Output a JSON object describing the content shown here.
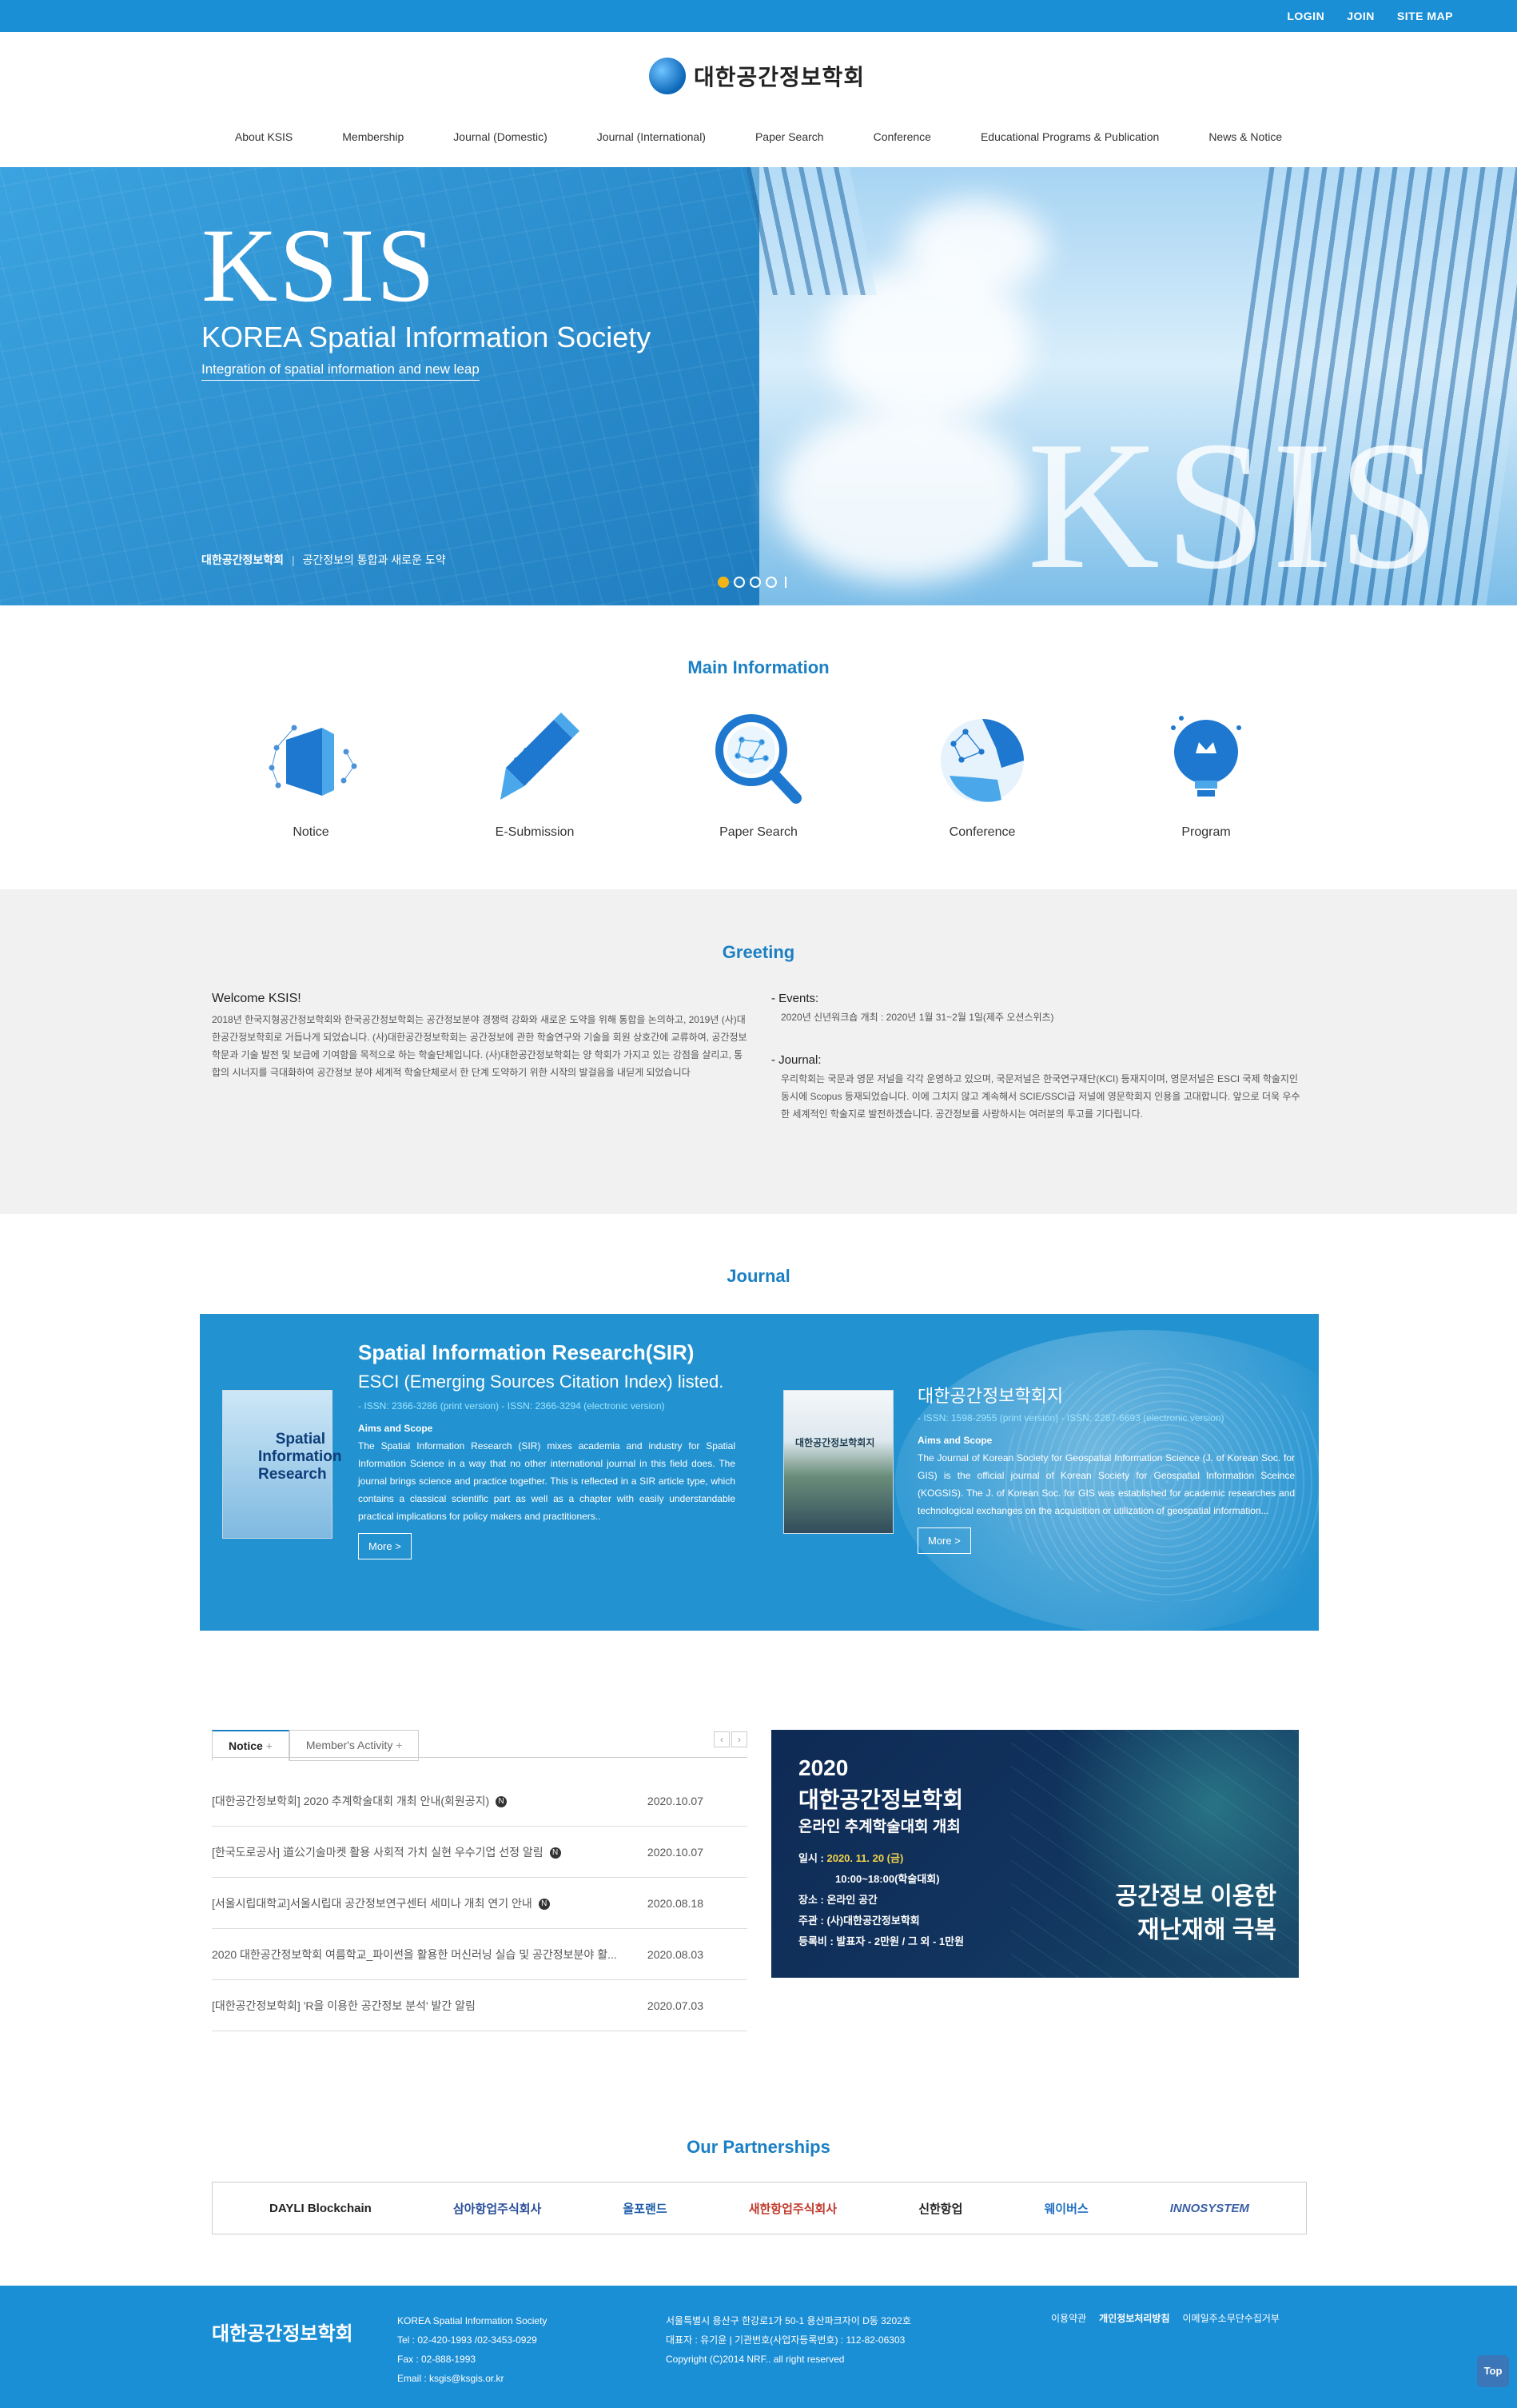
{
  "topbar": {
    "login": "LOGIN",
    "join": "JOIN",
    "sitemap": "SITE MAP"
  },
  "header": {
    "logo_text": "대한공간정보학회"
  },
  "nav": {
    "items": [
      "About KSIS",
      "Membership",
      "Journal (Domestic)",
      "Journal (International)",
      "Paper Search",
      "Conference",
      "Educational Programs & Publication",
      "News & Notice"
    ]
  },
  "hero": {
    "title": "KSIS",
    "subtitle": "KOREA Spatial Information Society",
    "tagline": "Integration of spatial information and new leap",
    "caption_bold": "대한공간정보학회",
    "caption_sep": "|",
    "caption": "공간정보의 통합과 새로운 도약",
    "bg_text": "KSIS",
    "slides": 4,
    "active_slide": 1
  },
  "main_info": {
    "title": "Main Information",
    "items": [
      {
        "label": "Notice",
        "icon": "notice-icon"
      },
      {
        "label": "E-Submission",
        "icon": "pen-icon"
      },
      {
        "label": "Paper Search",
        "icon": "magnifier-icon"
      },
      {
        "label": "Conference",
        "icon": "globe-network-icon"
      },
      {
        "label": "Program",
        "icon": "lightbulb-icon"
      }
    ]
  },
  "greeting": {
    "title": "Greeting",
    "welcome": "Welcome KSIS!",
    "body": "2018년 한국지형공간정보학회와 한국공간정보학회는 공간정보분야 경쟁력 강화와 새로운 도약을 위해 통합을 논의하고, 2019년 (사)대한공간정보학회로 거듭나게 되었습니다. (사)대한공간정보학회는 공간정보에 관한 학술연구와 기술을 회원 상호간에 교류하여, 공간정보 학문과 기술 발전 및 보급에 기여함을 목적으로 하는 학술단체입니다. (사)대한공간정보학회는 양 학회가 가지고 있는 강점을 살리고, 통합의 시너지를 극대화하여 공간정보 분야 세계적 학술단체로서 한 단계 도약하기 위한 시작의 발걸음을 내딛게 되었습니다",
    "events_title": "- Events:",
    "events_body": "2020년 신년워크숍 개최 : 2020년 1월 31~2월 1일(제주 오션스위츠)",
    "journal_title": "- Journal:",
    "journal_body": "우리학회는 국문과 영문 저널을 각각 운영하고 있으며, 국문저널은 한국연구재단(KCI) 등재지이며, 영문저널은 ESCI 국제 학술지인 동시에 Scopus 등재되었습니다. 이에 그치지 않고 계속해서 SCIE/SSCI급 저널에 영문학회지 인용을 고대합니다. 앞으로 더욱 우수한 세계적인 학술지로 발전하겠습니다. 공간정보를 사랑하시는 여러분의 투고를 기다립니다."
  },
  "journal": {
    "title": "Journal",
    "sir": {
      "cover_text": "Spatial Information Research",
      "name": "Spatial Information Research(SIR)",
      "listed": "ESCI (Emerging Sources Citation Index) listed.",
      "issn": "- ISSN: 2366-3286 (print version) - ISSN: 2366-3294 (electronic version)",
      "aims": "Aims and Scope",
      "body": "The Spatial Information Research (SIR) mixes academia and industry for Spatial Information Science in a way that no other international journal in this field does. The journal brings science and practice together. This is reflected in a SIR article type, which contains a classical scientific part as well as a chapter with easily understandable practical implications for policy makers and practitioners..",
      "more": "More >"
    },
    "gis": {
      "cover_text": "대한공간정보학회지",
      "name": "대한공간정보학회지",
      "issn": "- ISSN: 1598-2955 (print version) - ISSN: 2287-6693 (electronic version)",
      "aims": "Aims and Scope",
      "body": "The Journal of Korean Society for Geospatial Information Science (J. of Korean Soc. for GIS) is the official journal of Korean Society for Geospatial Information Sceince (KOGSIS). The J. of Korean Soc. for GIS was established for academic researches and technological exchanges on the acquisition or utilization of geospatial information...",
      "more": "More >"
    }
  },
  "notice": {
    "tab_notice": "Notice",
    "tab_activity": "Member's Activity",
    "plus": "+",
    "prev": "‹",
    "next": "›",
    "rows": [
      {
        "title": "[대한공간정보학회] 2020 추계학술대회 개최 안내(회원공지)",
        "date": "2020.10.07",
        "new": true
      },
      {
        "title": "[한국도로공사] 道公기술마켓 활용 사회적 가치 실현 우수기업 선정 알림",
        "date": "2020.10.07",
        "new": true
      },
      {
        "title": "[서울시립대학교]서울시립대 공간정보연구센터 세미나 개최 연기 안내",
        "date": "2020.08.18",
        "new": true
      },
      {
        "title": "2020 대한공간정보학회 여름학교_파이썬을 활용한 머신러닝 실습 및 공간정보분야 활...",
        "date": "2020.08.03",
        "new": false
      },
      {
        "title": "[대한공간정보학회] 'R을 이용한 공간정보 분석' 발간 알림",
        "date": "2020.07.03",
        "new": false
      }
    ],
    "new_mark": "N"
  },
  "banner": {
    "year": "2020",
    "line1": "대한공간정보학회",
    "line2": "온라인 추계학술대회 개최",
    "date_label": "일시 : ",
    "date_value": "2020. 11. 20 (금)",
    "time": "10:00~18:00(학술대회)",
    "place": "장소 : 온라인 공간",
    "host": "주관 : (사)대한공간정보학회",
    "fee": "등록비 : 발표자 - 2만원 / 그 외 - 1만원",
    "slogan1": "공간정보 이용한",
    "slogan2": "재난재해 극복"
  },
  "partners": {
    "title": "Our Partnerships",
    "items": [
      "DAYLI Blockchain",
      "삼아항업주식회사",
      "올포랜드",
      "새한항업주식회사",
      "신한항업",
      "웨이버스",
      "INNOSYSTEM"
    ]
  },
  "footer": {
    "logo": "대한공간정보학회",
    "col1": [
      "KOREA Spatial Information Society",
      "Tel : 02-420-1993 /02-3453-0929",
      "Fax : 02-888-1993",
      "Email : ksgis@ksgis.or.kr"
    ],
    "col2": [
      "서울특별시 용산구 한강로1가 50-1 용산파크자이 D동 3202호",
      "대표자 : 유기윤  |  기관번호(사업자등록번호) : 112-82-06303",
      "Copyright (C)2014 NRF.. all right reserved"
    ],
    "links": [
      "이용약관",
      "개인정보처리방침",
      "이메일주소무단수집거부"
    ],
    "top": "Top"
  },
  "colors": {
    "brand": "#1b8fd6",
    "title_blue": "#1b7fc4",
    "journal_bg": "#2292d0",
    "accent_yellow": "#f3b515"
  }
}
